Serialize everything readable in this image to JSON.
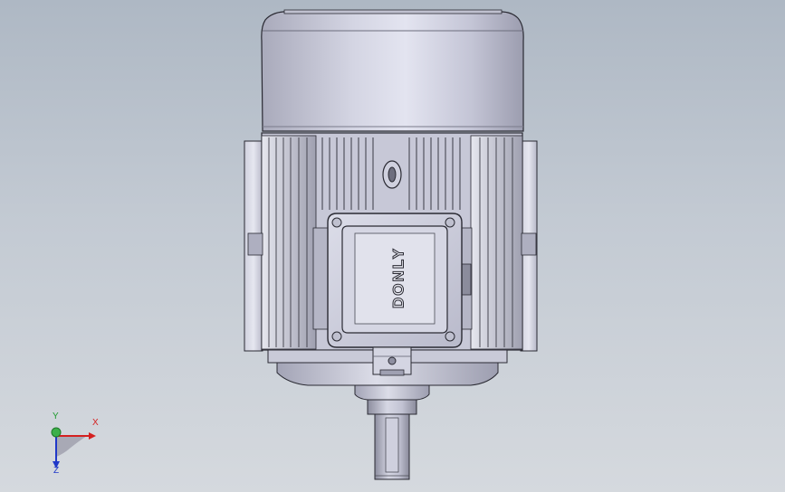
{
  "viewport": {
    "model": {
      "nameplate_text": "DONLY",
      "colors": {
        "body_light": "#d7d8e6",
        "body_mid": "#a9aabd",
        "body_dark": "#6f7081",
        "outline": "#2a2a33",
        "shadow": "#55565f"
      }
    }
  },
  "triad": {
    "x_label": "X",
    "y_label": "Y",
    "z_label": "Z",
    "colors": {
      "x": "#d42020",
      "y": "#1f9a2f",
      "z": "#2038c8"
    }
  }
}
